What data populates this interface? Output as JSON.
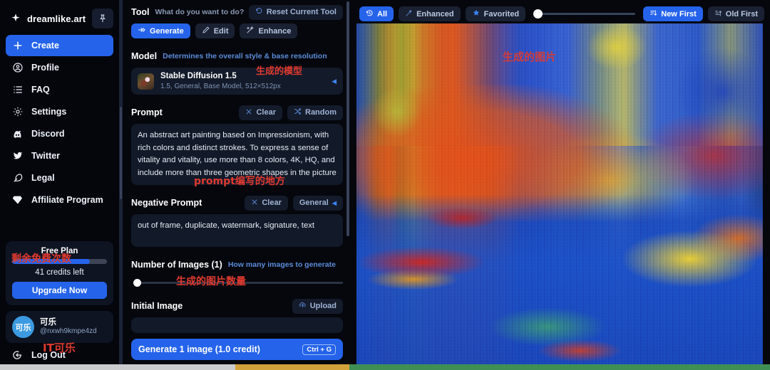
{
  "sidebar": {
    "brand": {
      "name": "dreamlike.art",
      "icon": "sparkle-icon",
      "pin_icon": "pin-icon"
    },
    "items": [
      {
        "label": "Create",
        "icon": "plus-icon",
        "active": true
      },
      {
        "label": "Profile",
        "icon": "user-circle-icon",
        "active": false
      },
      {
        "label": "FAQ",
        "icon": "list-icon",
        "active": false
      },
      {
        "label": "Settings",
        "icon": "gear-icon",
        "active": false
      },
      {
        "label": "Discord",
        "icon": "discord-icon",
        "active": false
      },
      {
        "label": "Twitter",
        "icon": "twitter-icon",
        "active": false
      },
      {
        "label": "Legal",
        "icon": "feather-icon",
        "active": false
      },
      {
        "label": "Affiliate Program",
        "icon": "diamond-icon",
        "active": false
      }
    ],
    "plan": {
      "title": "Free Plan",
      "credits": "41 credits left",
      "progress_percent": 82,
      "upgrade_label": "Upgrade Now",
      "annotation": "剩余免费次数"
    },
    "user": {
      "avatar_text": "可乐",
      "name": "可乐",
      "handle": "@nxwh9kmpe4zd",
      "annotation": "IT可乐"
    },
    "logout": {
      "label": "Log Out",
      "icon": "logout-icon"
    }
  },
  "tool": {
    "title": "Tool",
    "subtitle": "What do you want to do?",
    "reset_label": "Reset Current Tool",
    "reset_icon": "reset-icon",
    "modes": [
      {
        "label": "Generate",
        "icon": "arrows-right-icon",
        "active": true
      },
      {
        "label": "Edit",
        "icon": "pencil-icon",
        "active": false
      },
      {
        "label": "Enhance",
        "icon": "wand-icon",
        "active": false
      }
    ]
  },
  "model": {
    "title": "Model",
    "subtitle": "Determines the overall style & base resolution",
    "name": "Stable Diffusion 1.5",
    "meta": "1.5, General, Base Model, 512×512px",
    "caret_icon": "chevron-left-icon",
    "annotation": "生成的模型"
  },
  "prompt": {
    "title": "Prompt",
    "clear_label": "Clear",
    "clear_icon": "close-icon",
    "random_label": "Random",
    "random_icon": "shuffle-icon",
    "value": "An abstract art painting based on Impressionism, with rich colors and distinct strokes. To express a sense of vitality and vitality, use more than 8 colors, 4K, HQ, and include more than three geometric shapes in the picture",
    "annotation": "prompt编写的地方"
  },
  "negative_prompt": {
    "title": "Negative Prompt",
    "clear_label": "Clear",
    "clear_icon": "close-icon",
    "preset_label": "General",
    "preset_icon": "chevron-left-icon",
    "value": "out of frame, duplicate, watermark, signature, text"
  },
  "number_of_images": {
    "title": "Number of Images (1)",
    "subtitle": "How many images to generate",
    "value": 1,
    "percent": 0,
    "annotation": "生成的图片数量"
  },
  "initial_image": {
    "title": "Initial Image",
    "upload_label": "Upload",
    "upload_icon": "upload-icon",
    "value": ""
  },
  "generate": {
    "label": "Generate 1 image (1.0 credit)",
    "shortcut": "Ctrl + G"
  },
  "gallery": {
    "filters": [
      {
        "label": "All",
        "icon": "history-icon",
        "active": true
      },
      {
        "label": "Enhanced",
        "icon": "wand-icon",
        "active": false
      },
      {
        "label": "Favorited",
        "icon": "star-icon",
        "active": false
      }
    ],
    "zoom_percent": 0,
    "sort": [
      {
        "label": "New First",
        "icon": "sort-desc-icon",
        "active": true
      },
      {
        "label": "Old First",
        "icon": "sort-asc-icon",
        "active": false
      }
    ],
    "image_annotation": "生成的图片",
    "image_alt": "Abstract impressionist painting with vertical streaks of blue, yellow, orange and red"
  },
  "colors": {
    "accent": "#2563eb",
    "panel": "#121a29",
    "background": "#05070d",
    "annotation_red": "#e03a2f",
    "muted_text": "#8b99b3"
  }
}
